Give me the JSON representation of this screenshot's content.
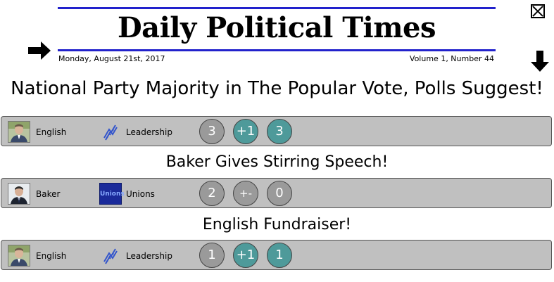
{
  "masthead": {
    "title": "Daily Political Times",
    "date": "Monday, August 21st, 2017",
    "volume": "Volume 1, Number 44"
  },
  "icons": {
    "next": "right-arrow-icon",
    "down": "down-arrow-icon",
    "close": "close-icon"
  },
  "stories": [
    {
      "headline": "National Party Majority in The Popular Vote, Polls Suggest!",
      "politician": "English",
      "issue": "Leadership",
      "issue_icon": "leadership-icon",
      "before": "3",
      "delta": "+1",
      "after": "3"
    },
    {
      "headline": "Baker Gives Stirring Speech!",
      "politician": "Baker",
      "issue": "Unions",
      "issue_icon_text": "Unions",
      "before": "2",
      "delta": "+-",
      "after": "0"
    },
    {
      "headline": "English Fundraiser!",
      "politician": "English",
      "issue": "Leadership",
      "issue_icon": "leadership-icon",
      "before": "1",
      "delta": "+1",
      "after": "1"
    }
  ],
  "colors": {
    "masthead_line": "#2222cc",
    "row_bg": "#c0c0c0",
    "circle_grey": "#9a9a9a",
    "circle_teal": "#4e9a9a"
  }
}
